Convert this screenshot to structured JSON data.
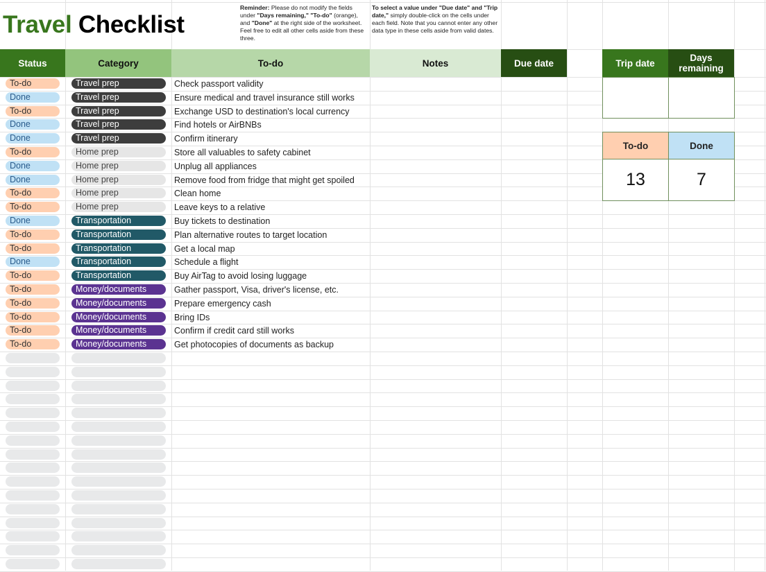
{
  "title": {
    "part1": "Travel",
    "part2": "Checklist"
  },
  "notes": {
    "reminder_label": "Reminder:",
    "reminder_text_1": " Please do not modify the fields under ",
    "reminder_days": "\"Days remaining,\"",
    "reminder_text_2": " ",
    "reminder_todo": "\"To-do\"",
    "reminder_text_3": " (orange), and ",
    "reminder_done": "\"Done\"",
    "reminder_text_4": " at the right side of the worksheet. Feel free to edit all other cells aside from these three.",
    "select_bold": "To select a value under \"Due date\" and \"Trip date,\"",
    "select_text": " simply double-click on the cells under each field. Note that you cannot enter any other data type in these cells aside from valid dates."
  },
  "headers": {
    "status": "Status",
    "category": "Category",
    "todo": "To-do",
    "notes": "Notes",
    "due_date": "Due date",
    "trip_date": "Trip date",
    "days_remaining": "Days remaining"
  },
  "colors": {
    "status_header": "#38761d",
    "category_header": "#93c47d",
    "todo_header": "#b6d7a8",
    "notes_header": "#d9ead3",
    "due_date_header": "#274e13",
    "trip_date_header": "#38761d",
    "days_remaining_header": "#274e13",
    "todo_status": "#ffcfb0",
    "done_status": "#c0e1f5"
  },
  "summary": {
    "todo_label": "To-do",
    "done_label": "Done",
    "todo_count": "13",
    "done_count": "7"
  },
  "tasks": [
    {
      "status": "To-do",
      "category": "Travel prep",
      "todo": "Check passport validity"
    },
    {
      "status": "Done",
      "category": "Travel prep",
      "todo": "Ensure medical and travel insurance still works"
    },
    {
      "status": "To-do",
      "category": "Travel prep",
      "todo": "Exchange USD to destination's local currency"
    },
    {
      "status": "Done",
      "category": "Travel prep",
      "todo": "Find hotels or AirBNBs"
    },
    {
      "status": "Done",
      "category": "Travel prep",
      "todo": "Confirm itinerary"
    },
    {
      "status": "To-do",
      "category": "Home prep",
      "todo": "Store all valuables to safety cabinet"
    },
    {
      "status": "Done",
      "category": "Home prep",
      "todo": "Unplug all appliances"
    },
    {
      "status": "Done",
      "category": "Home prep",
      "todo": "Remove food from fridge that might get spoiled"
    },
    {
      "status": "To-do",
      "category": "Home prep",
      "todo": "Clean home"
    },
    {
      "status": "To-do",
      "category": "Home prep",
      "todo": "Leave keys to a relative"
    },
    {
      "status": "Done",
      "category": "Transportation",
      "todo": "Buy tickets to destination"
    },
    {
      "status": "To-do",
      "category": "Transportation",
      "todo": "Plan alternative routes to target location"
    },
    {
      "status": "To-do",
      "category": "Transportation",
      "todo": "Get a local map"
    },
    {
      "status": "Done",
      "category": "Transportation",
      "todo": "Schedule a flight"
    },
    {
      "status": "To-do",
      "category": "Transportation",
      "todo": "Buy AirTag to avoid losing luggage"
    },
    {
      "status": "To-do",
      "category": "Money/documents",
      "todo": "Gather passport, Visa, driver's license, etc."
    },
    {
      "status": "To-do",
      "category": "Money/documents",
      "todo": "Prepare emergency cash"
    },
    {
      "status": "To-do",
      "category": "Money/documents",
      "todo": "Bring IDs"
    },
    {
      "status": "To-do",
      "category": "Money/documents",
      "todo": "Confirm if credit card still works"
    },
    {
      "status": "To-do",
      "category": "Money/documents",
      "todo": "Get photocopies of documents as backup"
    }
  ]
}
